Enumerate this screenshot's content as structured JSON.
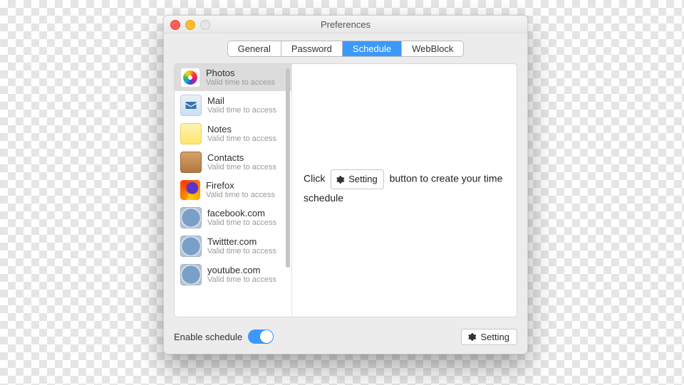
{
  "window": {
    "title": "Preferences"
  },
  "tabs": [
    {
      "label": "General",
      "active": false
    },
    {
      "label": "Password",
      "active": false
    },
    {
      "label": "Schedule",
      "active": true
    },
    {
      "label": "WebBlock",
      "active": false
    }
  ],
  "sidebar": {
    "subtitle": "Valid time to access",
    "items": [
      {
        "label": "Photos",
        "icon": "photos-icon"
      },
      {
        "label": "Mail",
        "icon": "mail-icon"
      },
      {
        "label": "Notes",
        "icon": "notes-icon"
      },
      {
        "label": "Contacts",
        "icon": "contacts-icon"
      },
      {
        "label": "Firefox",
        "icon": "firefox-icon"
      },
      {
        "label": "facebook.com",
        "icon": "safari-icon"
      },
      {
        "label": "Twittter.com",
        "icon": "safari-icon"
      },
      {
        "label": "youtube.com",
        "icon": "safari-icon"
      }
    ],
    "selected_index": 0
  },
  "detail": {
    "hint_before": "Click",
    "hint_button": "Setting",
    "hint_after": "button to create your time schedule"
  },
  "bottom": {
    "enable_label": "Enable schedule",
    "enable_on": true,
    "setting_label": "Setting"
  }
}
